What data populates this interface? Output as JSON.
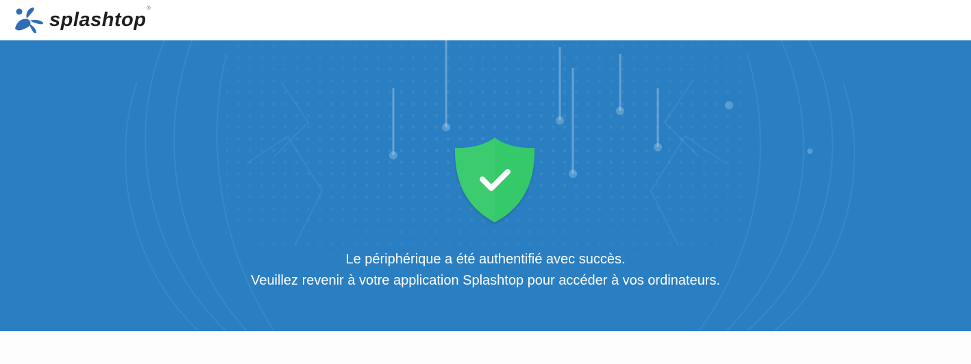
{
  "header": {
    "logo_text": "splashtop",
    "logo_registered": "®",
    "logo_icon": "splashtop-splash-icon"
  },
  "hero": {
    "status_icon": "shield-check-icon",
    "message_line1": "Le périphérique a été authentifié avec succès.",
    "message_line2": "Veuillez revenir à votre application Splashtop pour accéder à vos ordinateurs."
  },
  "colors": {
    "brand_blue": "#2a7fc2",
    "logo_blue": "#2f6db5",
    "success_green": "#35c96b",
    "text_white": "#ffffff"
  }
}
